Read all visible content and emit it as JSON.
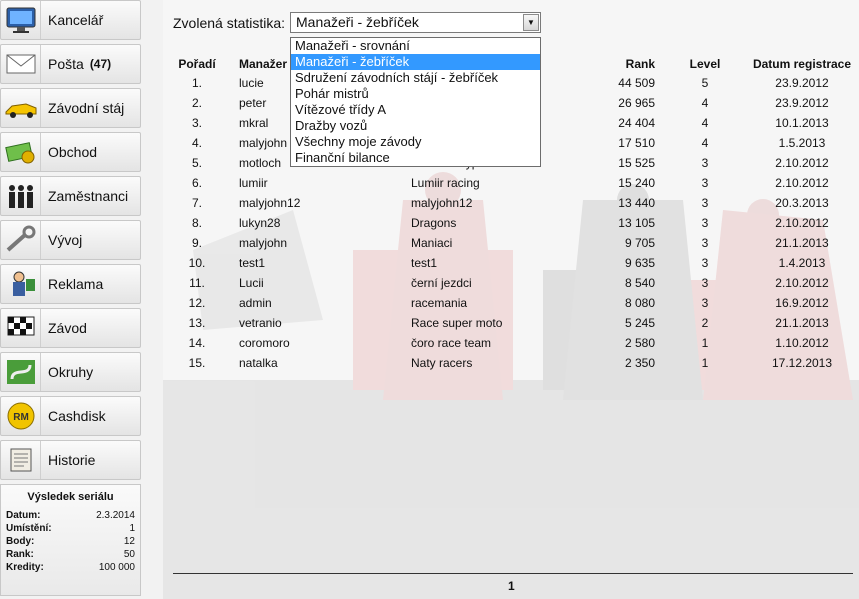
{
  "sidebar": {
    "items": [
      {
        "label": "Kancelář",
        "icon": "computer-monitor-icon",
        "count": ""
      },
      {
        "label": "Pošta",
        "icon": "envelope-icon",
        "count": "(47)"
      },
      {
        "label": "Závodní stáj",
        "icon": "race-car-icon",
        "count": ""
      },
      {
        "label": "Obchod",
        "icon": "money-icon",
        "count": ""
      },
      {
        "label": "Zaměstnanci",
        "icon": "people-icon",
        "count": ""
      },
      {
        "label": "Vývoj",
        "icon": "wrench-icon",
        "count": ""
      },
      {
        "label": "Reklama",
        "icon": "promoter-icon",
        "count": ""
      },
      {
        "label": "Závod",
        "icon": "checkered-flag-icon",
        "count": ""
      },
      {
        "label": "Okruhy",
        "icon": "track-icon",
        "count": ""
      },
      {
        "label": "Cashdisk",
        "icon": "rm-coin-icon",
        "count": ""
      },
      {
        "label": "Historie",
        "icon": "scroll-icon",
        "count": ""
      }
    ],
    "series": {
      "title": "Výsledek seriálu",
      "rows": [
        {
          "key": "Datum:",
          "value": "2.3.2014"
        },
        {
          "key": "Umístění:",
          "value": "1"
        },
        {
          "key": "Body:",
          "value": "12"
        },
        {
          "key": "Rank:",
          "value": "50"
        },
        {
          "key": "Kredity:",
          "value": "100 000"
        }
      ]
    }
  },
  "main": {
    "stat_label": "Zvolená statistika:",
    "stat_selected": "Manažeři - žebříček",
    "dropdown_options": [
      {
        "label": "Manažeři - srovnání",
        "selected": false
      },
      {
        "label": "Manažeři - žebříček",
        "selected": true
      },
      {
        "label": "Sdružení závodních stájí - žebříček",
        "selected": false
      },
      {
        "label": "Pohár mistrů",
        "selected": false
      },
      {
        "label": "Vítězové třídy A",
        "selected": false
      },
      {
        "label": "Dražby vozů",
        "selected": false
      },
      {
        "label": "Všechny moje závody",
        "selected": false
      },
      {
        "label": "Finanční bilance",
        "selected": false
      }
    ],
    "table": {
      "headers": {
        "rank": "Pořadí",
        "manager": "Manažer",
        "team": "",
        "score": "Rank",
        "level": "Level",
        "date": "Datum registrace"
      },
      "rows": [
        {
          "rank": "1.",
          "manager": "lucie",
          "team": "",
          "score": "44 509",
          "level": "5",
          "date": "23.9.2012"
        },
        {
          "rank": "2.",
          "manager": "peter",
          "team": "",
          "score": "26 965",
          "level": "4",
          "date": "23.9.2012"
        },
        {
          "rank": "3.",
          "manager": "mkral",
          "team": "",
          "score": "24 404",
          "level": "4",
          "date": "10.1.2013"
        },
        {
          "rank": "4.",
          "manager": "malyjohn",
          "team": "",
          "score": "17 510",
          "level": "4",
          "date": "1.5.2013"
        },
        {
          "rank": "5.",
          "manager": "motloch",
          "team": "testovací typer",
          "score": "15 525",
          "level": "3",
          "date": "2.10.2012"
        },
        {
          "rank": "6.",
          "manager": "lumiir",
          "team": "Lumiir racing",
          "score": "15 240",
          "level": "3",
          "date": "2.10.2012"
        },
        {
          "rank": "7.",
          "manager": "malyjohn12",
          "team": "malyjohn12",
          "score": "13 440",
          "level": "3",
          "date": "20.3.2013"
        },
        {
          "rank": "8.",
          "manager": "lukyn28",
          "team": "Dragons",
          "score": "13 105",
          "level": "3",
          "date": "2.10.2012"
        },
        {
          "rank": "9.",
          "manager": "malyjohn",
          "team": "Maniaci",
          "score": "9 705",
          "level": "3",
          "date": "21.1.2013"
        },
        {
          "rank": "10.",
          "manager": "test1",
          "team": "test1",
          "score": "9 635",
          "level": "3",
          "date": "1.4.2013"
        },
        {
          "rank": "11.",
          "manager": "Lucii",
          "team": "černí jezdci",
          "score": "8 540",
          "level": "3",
          "date": "2.10.2012"
        },
        {
          "rank": "12.",
          "manager": "admin",
          "team": "racemania",
          "score": "8 080",
          "level": "3",
          "date": "16.9.2012"
        },
        {
          "rank": "13.",
          "manager": "vetranio",
          "team": "Race super moto",
          "score": "5 245",
          "level": "2",
          "date": "21.1.2013"
        },
        {
          "rank": "14.",
          "manager": "coromoro",
          "team": "čoro race team",
          "score": "2 580",
          "level": "1",
          "date": "1.10.2012"
        },
        {
          "rank": "15.",
          "manager": "natalka",
          "team": "Naty racers",
          "score": "2 350",
          "level": "1",
          "date": "17.12.2013"
        }
      ]
    },
    "page_number": "1"
  }
}
